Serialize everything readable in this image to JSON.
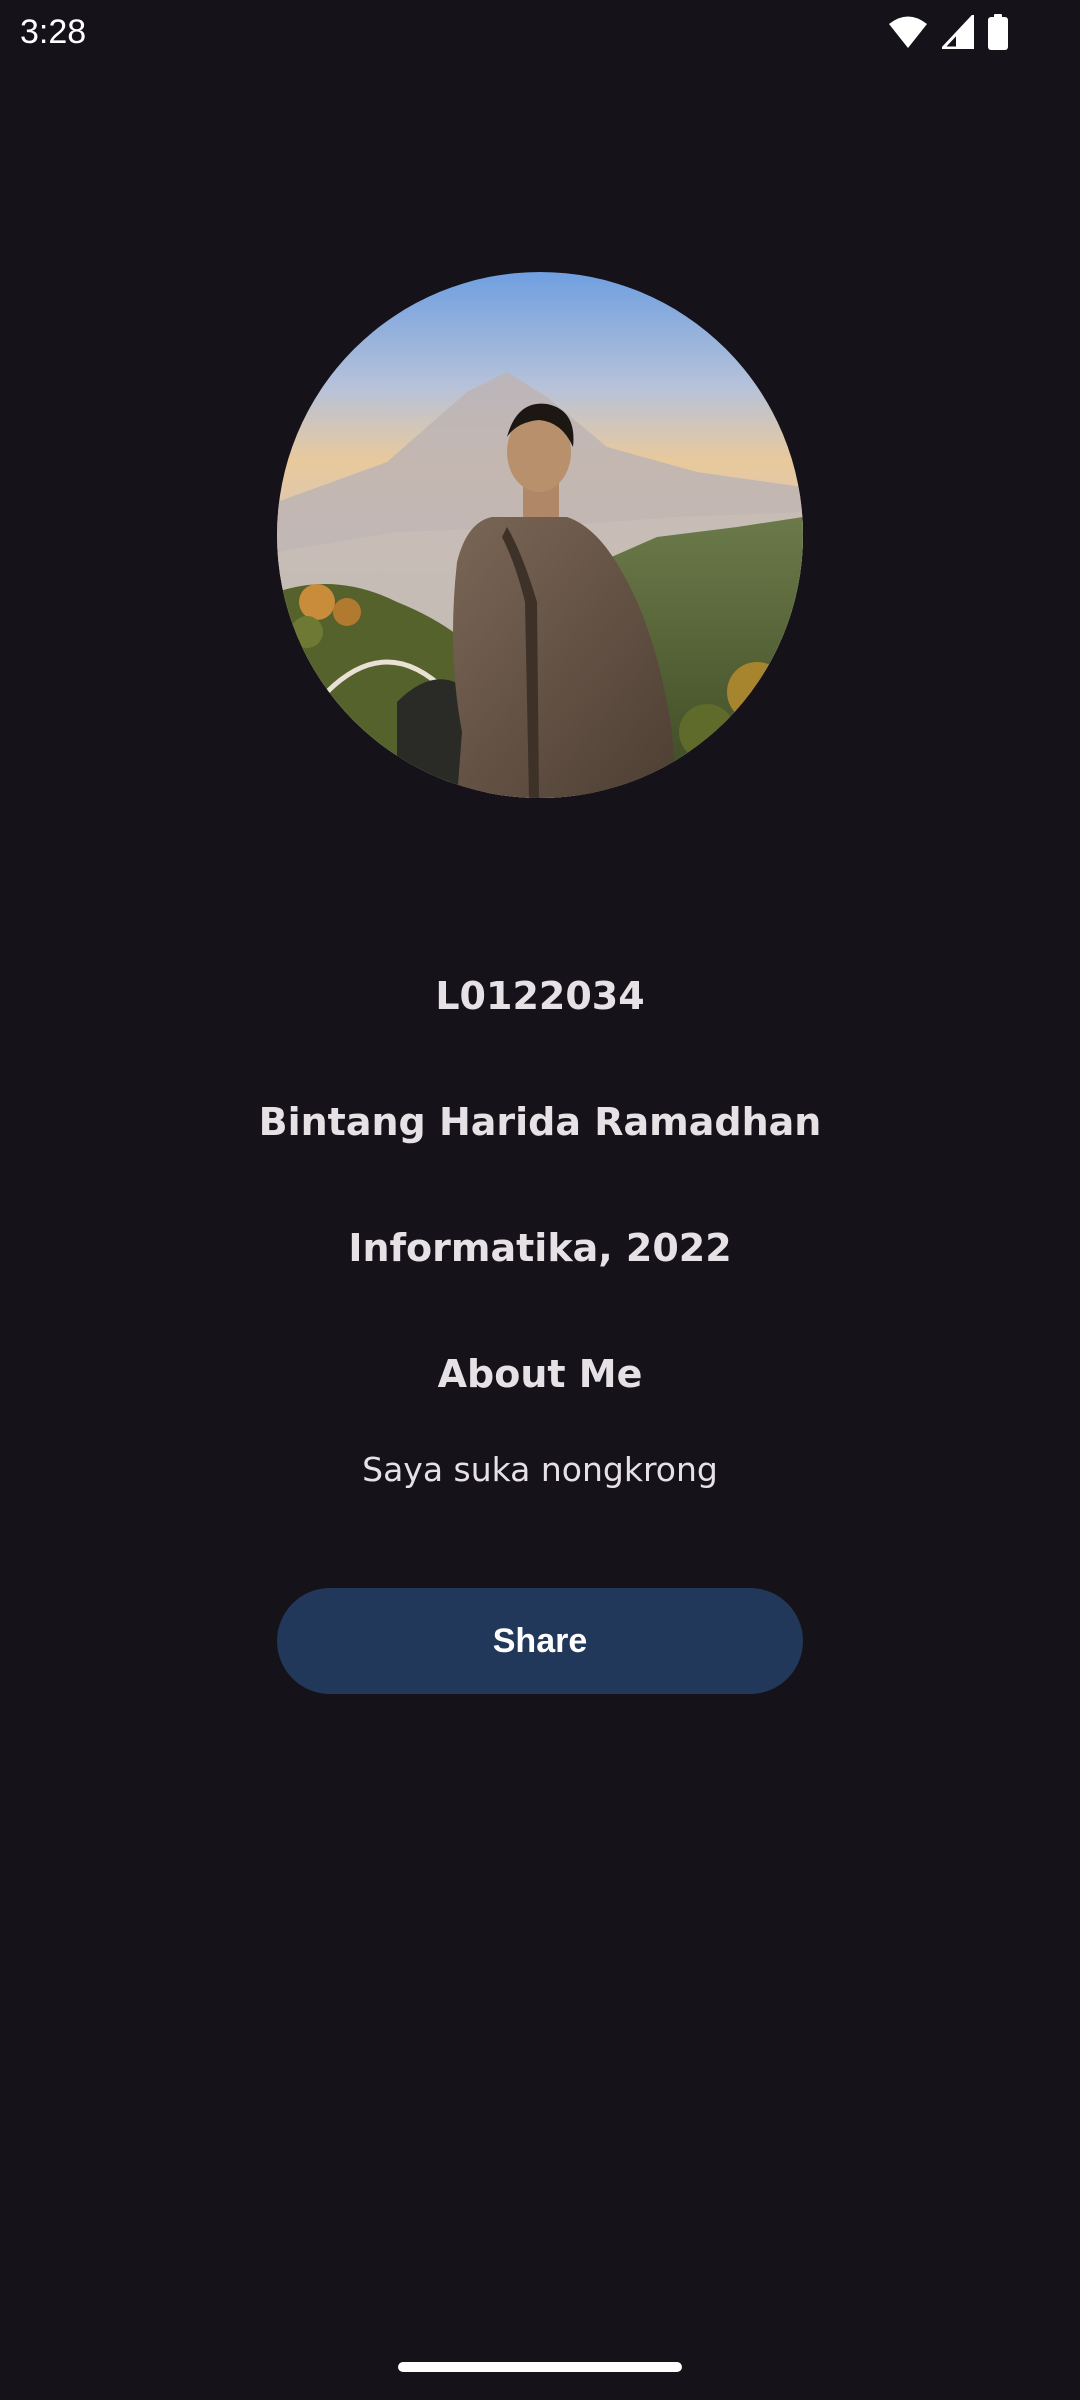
{
  "status_bar": {
    "time": "3:28",
    "icons": [
      "wifi-icon",
      "cellular-signal-icon",
      "battery-icon"
    ]
  },
  "profile": {
    "nim": "L0122034",
    "name": "Bintang Harida Ramadhan",
    "program_year": "Informatika, 2022",
    "about_title": "About Me",
    "about_text": "Saya suka nongkrong"
  },
  "actions": {
    "share_label": "Share"
  },
  "colors": {
    "background": "#15121a",
    "button": "#22385a",
    "text": "#e6e1e5"
  }
}
